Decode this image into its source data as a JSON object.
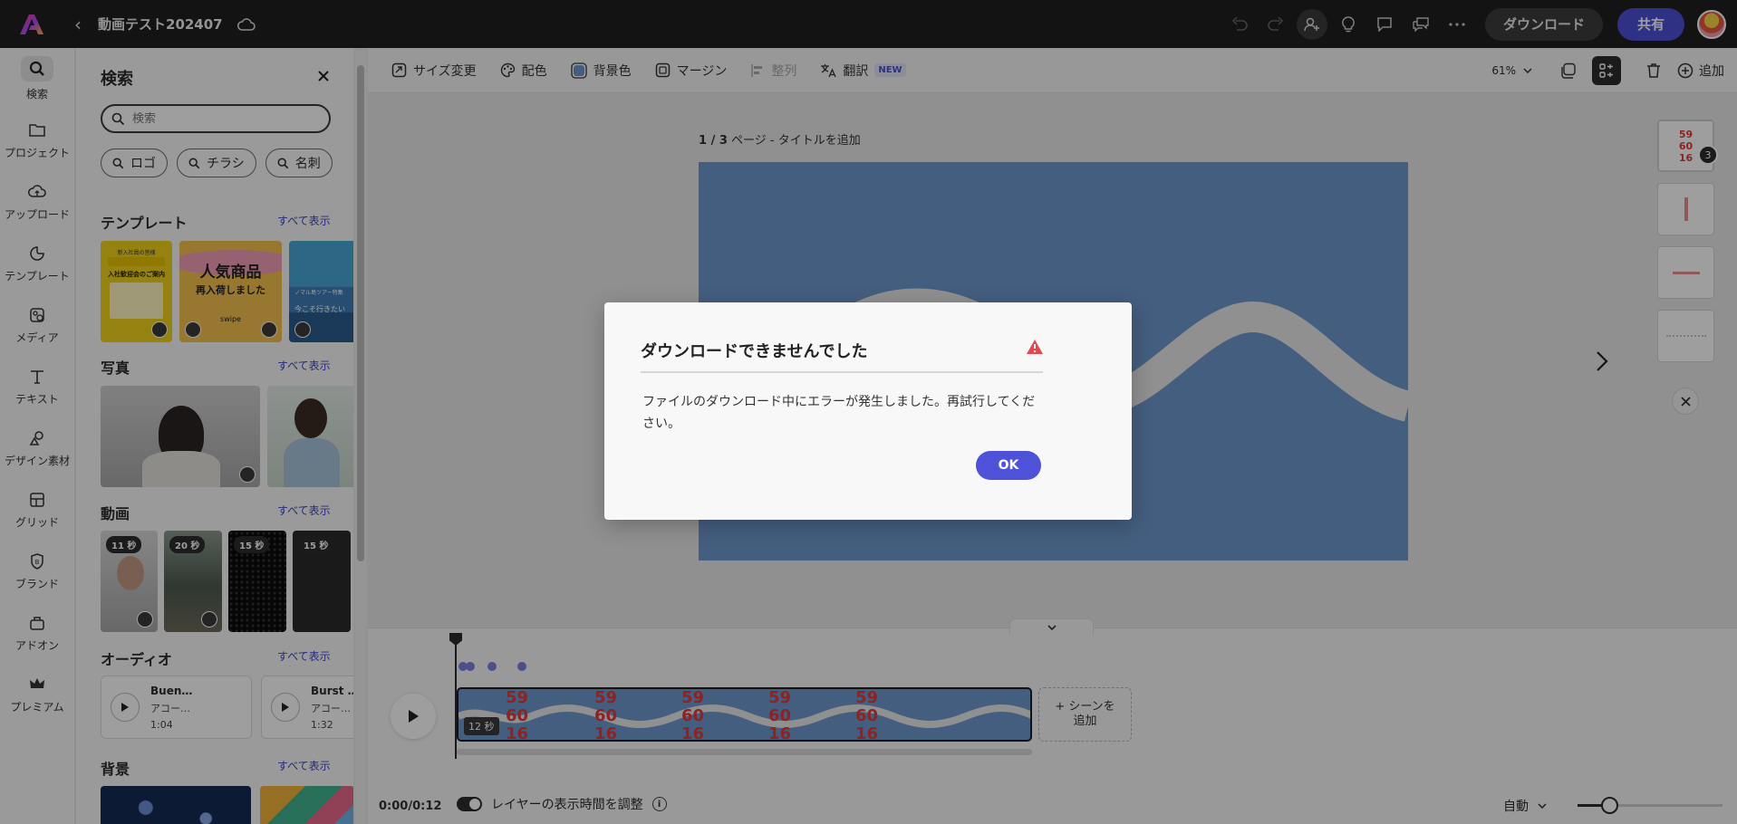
{
  "app": {
    "doc_title": "動画テスト202407"
  },
  "header": {
    "download_label": "ダウンロード",
    "share_label": "共有"
  },
  "rail": [
    {
      "label": "検索",
      "icon": "search-icon"
    },
    {
      "label": "プロジェクト",
      "icon": "folder-icon"
    },
    {
      "label": "アップロード",
      "icon": "upload-icon"
    },
    {
      "label": "テンプレート",
      "icon": "template-icon"
    },
    {
      "label": "メディア",
      "icon": "media-icon"
    },
    {
      "label": "テキスト",
      "icon": "text-icon"
    },
    {
      "label": "デザイン素材",
      "icon": "shapes-icon"
    },
    {
      "label": "グリッド",
      "icon": "grid-icon"
    },
    {
      "label": "ブランド",
      "icon": "brand-icon"
    },
    {
      "label": "アドオン",
      "icon": "addon-icon"
    },
    {
      "label": "プレミアム",
      "icon": "premium-crown-icon"
    }
  ],
  "panel": {
    "title": "検索",
    "search_placeholder": "検索",
    "chips": [
      "ロゴ",
      "チラシ",
      "名刺"
    ],
    "see_all": "すべて表示",
    "sections": {
      "templates": "テンプレート",
      "photos": "写真",
      "videos": "動画",
      "audio": "オーディオ",
      "backgrounds": "背景"
    },
    "template_thumbs": [
      {
        "line1": "新入社員の皆様",
        "line2": "入社歓迎会のご案内"
      },
      {
        "line1": "人気商品",
        "line2": "再入荷しました",
        "line3": "swipe"
      },
      {
        "line1": "ノマル島ツアー特集",
        "line2": "今こそ行きたい"
      }
    ],
    "video_durations": [
      "11 秒",
      "20 秒",
      "15 秒",
      "15 秒"
    ],
    "audio": [
      {
        "title": "Buen…",
        "artist": "アコー…",
        "duration": "1:04"
      },
      {
        "title": "Burst …",
        "artist": "アコー…",
        "duration": "1:32"
      }
    ]
  },
  "toolbar": {
    "items": [
      {
        "label": "サイズ変更",
        "icon": "resize-icon"
      },
      {
        "label": "配色",
        "icon": "palette-icon"
      },
      {
        "label": "背景色",
        "icon": "bg-color-icon"
      },
      {
        "label": "マージン",
        "icon": "margin-icon"
      },
      {
        "label": "整列",
        "icon": "align-icon"
      },
      {
        "label": "翻訳",
        "icon": "translate-icon",
        "tag": "NEW"
      }
    ],
    "zoom": "61%",
    "add_label": "追加"
  },
  "canvas": {
    "page_label_count": "1 / 3",
    "page_label_text": " ページ - タイトルを追加",
    "page_count_badge": "3",
    "thumb_numbers": [
      "59",
      "60",
      "16"
    ]
  },
  "timeline": {
    "clip_duration": "12 秒",
    "clip_numbers": [
      "59",
      "60",
      "16"
    ],
    "add_scene_line1": "+ シーンを",
    "add_scene_line2": "追加",
    "time": "0:00/0:12",
    "layer_toggle_label": "レイヤーの表示時間を調整",
    "auto_label": "自動",
    "zoom_level": 0.22
  },
  "modal": {
    "title": "ダウンロードできませんでした",
    "body": "ファイルのダウンロード中にエラーが発生しました。再試行してください。",
    "ok_label": "OK",
    "warn_color": "#e34850"
  },
  "colors": {
    "accent": "#4b4fd6",
    "artboard": "#6f98cd",
    "clip_numbers": "#e03a3a"
  }
}
